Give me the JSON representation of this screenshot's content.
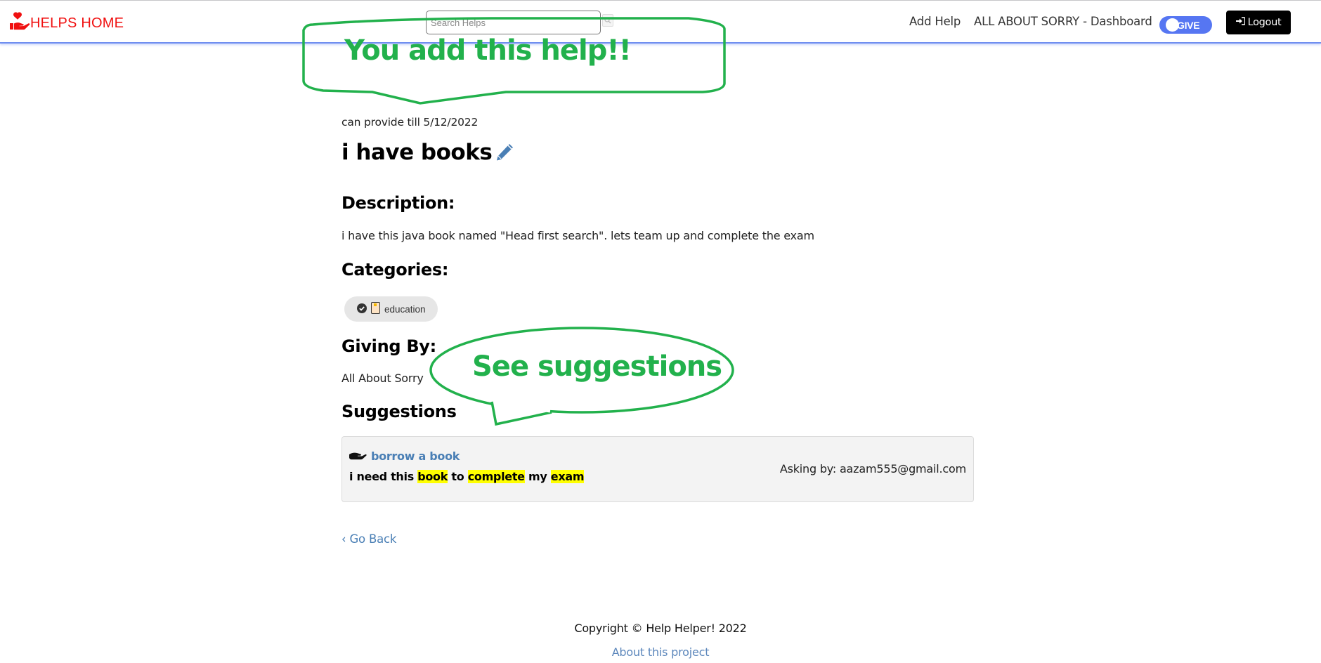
{
  "navbar": {
    "brand": "HELPS HOME",
    "brand_icon": "hand-holding-heart-icon",
    "search_placeholder": "Search Helps",
    "search_value": "",
    "search_icon": "search-icon",
    "links": [
      {
        "label": "Add Help"
      },
      {
        "label": "ALL ABOUT SORRY - Dashboard"
      }
    ],
    "mode_toggle": {
      "label": "GIVE",
      "state": "on"
    },
    "logout": {
      "label": "Logout",
      "icon": "sign-in-icon"
    }
  },
  "help": {
    "availability": "can provide till 5/12/2022",
    "title": "i have books",
    "edit_icon": "pencil-icon",
    "description_heading": "Description:",
    "description": "i have this java book named \"Head first search\". lets team up and complete the exam",
    "categories_heading": "Categories:",
    "categories": [
      {
        "label": "education",
        "icons": [
          "check-circle-icon",
          "book-icon"
        ]
      }
    ],
    "giving_by_heading": "Giving By:",
    "giving_by": "All About Sorry"
  },
  "suggestions": {
    "heading": "Suggestions",
    "items": [
      {
        "icon": "hand-open-icon",
        "title": "borrow a book",
        "text_parts": [
          {
            "text": "i need this ",
            "highlight": false
          },
          {
            "text": "book",
            "highlight": true
          },
          {
            "text": " to ",
            "highlight": false
          },
          {
            "text": "complete",
            "highlight": true
          },
          {
            "text": " my ",
            "highlight": false
          },
          {
            "text": "exam",
            "highlight": true
          }
        ],
        "asker": "Asking by: aazam555@gmail.com"
      }
    ],
    "highlight_color": "#ffff00"
  },
  "go_back": "‹ Go Back",
  "footer": {
    "copyright": "Copyright © Help Helper! 2022",
    "about_link": "About this project"
  },
  "annotations": [
    {
      "text": "You add this help!!",
      "shape": "speech-bubble"
    },
    {
      "text": "See suggestions",
      "shape": "speech-bubble-oval"
    }
  ],
  "colors": {
    "brand": "#f01010",
    "navbar_border": "#6f8ef0",
    "toggle": "#5676f2",
    "link": "#4a7fb5",
    "annotation": "#22b14c"
  }
}
